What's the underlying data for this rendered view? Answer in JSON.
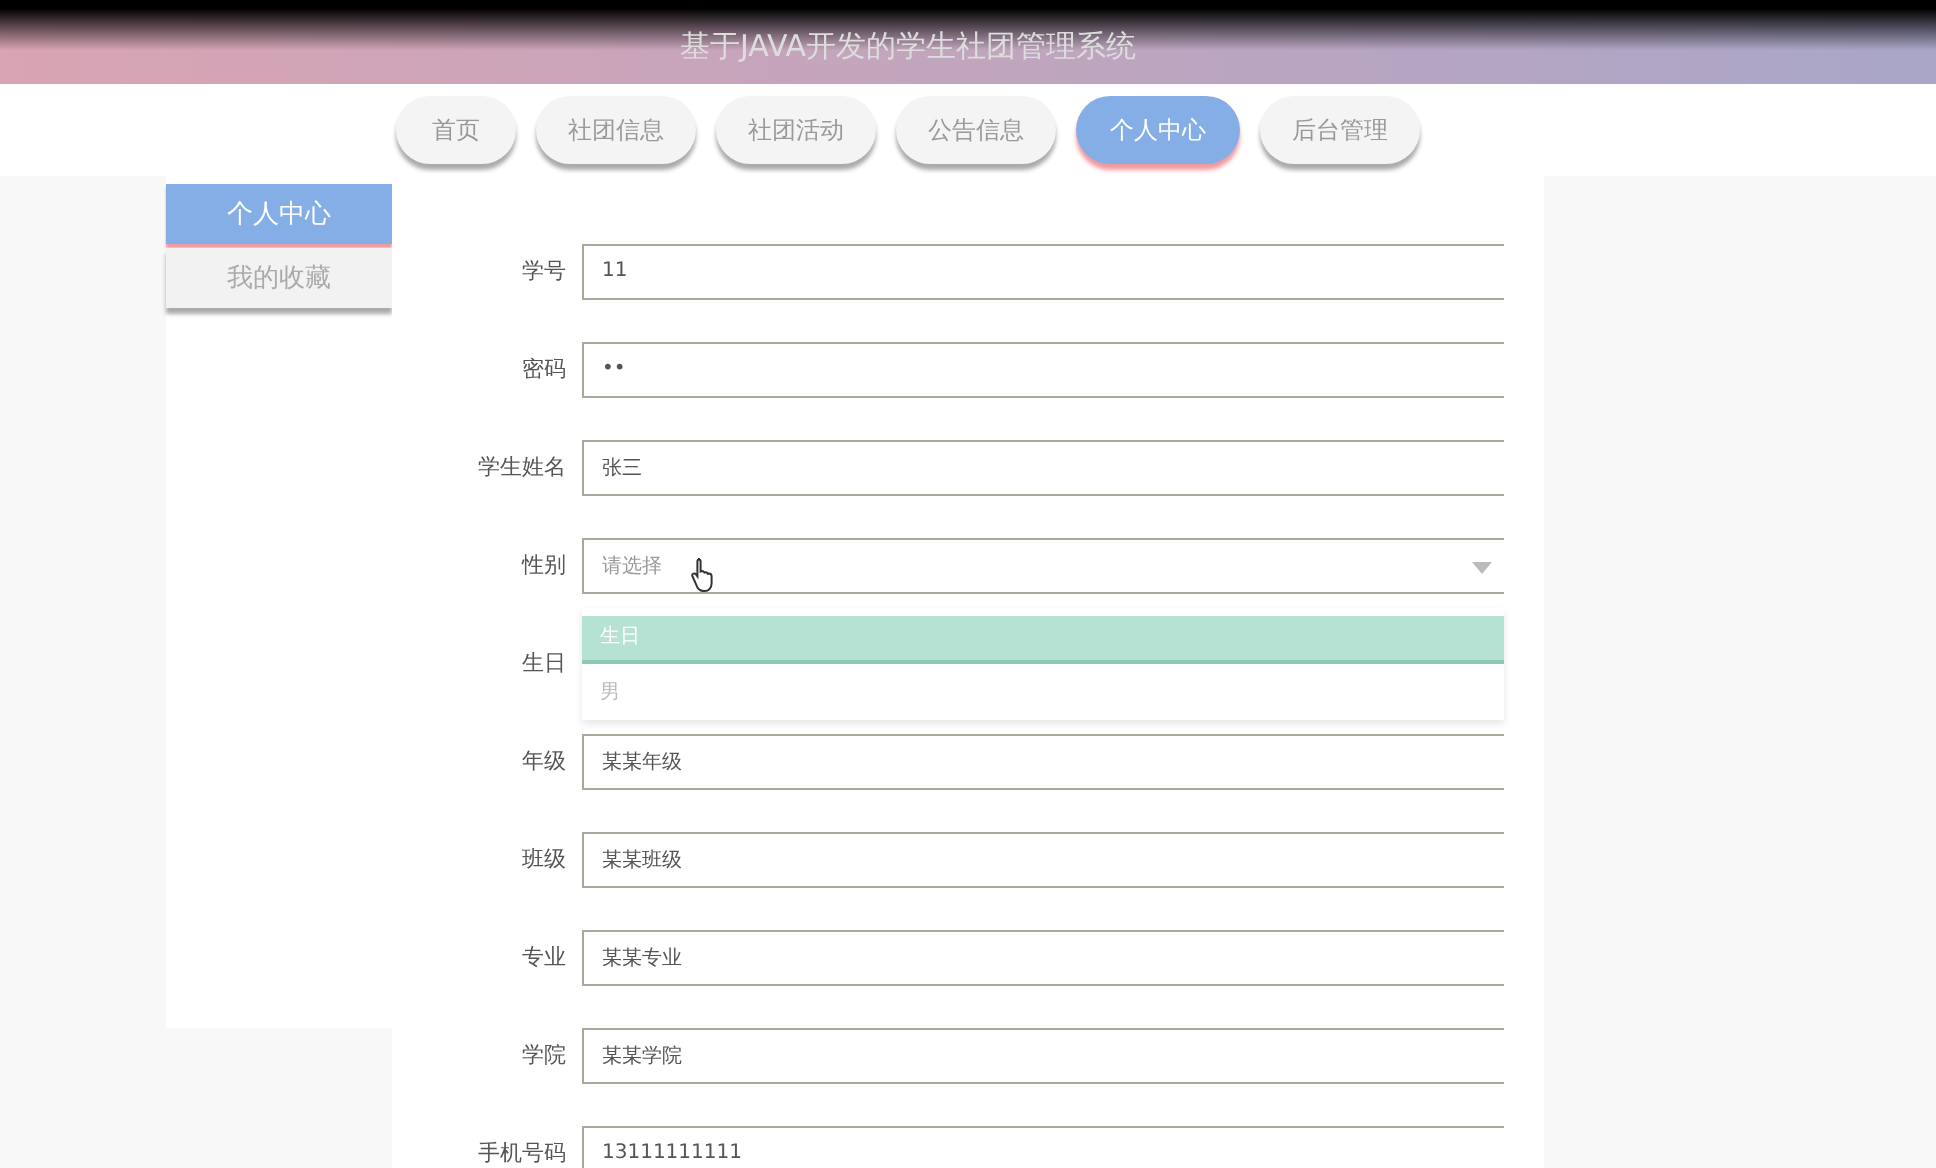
{
  "header": {
    "title": "基于JAVA开发的学生社团管理系统"
  },
  "nav": [
    {
      "label": "首页",
      "selected": false
    },
    {
      "label": "社团信息",
      "selected": false
    },
    {
      "label": "社团活动",
      "selected": false
    },
    {
      "label": "公告信息",
      "selected": false
    },
    {
      "label": "个人中心",
      "selected": true
    },
    {
      "label": "后台管理",
      "selected": false
    }
  ],
  "sidebar": {
    "items": [
      {
        "label": "个人中心",
        "selected": true
      },
      {
        "label": "我的收藏",
        "selected": false
      }
    ]
  },
  "form": {
    "fields": [
      {
        "kind": "text",
        "label": "学号",
        "value": "11"
      },
      {
        "kind": "text",
        "label": "密码",
        "value": "••"
      },
      {
        "kind": "text",
        "label": "学生姓名",
        "value": "张三"
      },
      {
        "kind": "select",
        "label": "性别",
        "placeholder": "请选择",
        "options": [
          {
            "label": "生日",
            "selected": true
          },
          {
            "label": "男",
            "selected": false
          }
        ]
      },
      {
        "kind": "covered",
        "label": "生日"
      },
      {
        "kind": "text",
        "label": "年级",
        "value": "某某年级"
      },
      {
        "kind": "text",
        "label": "班级",
        "value": "某某班级"
      },
      {
        "kind": "text",
        "label": "专业",
        "value": "某某专业"
      },
      {
        "kind": "text",
        "label": "学院",
        "value": "某某学院"
      },
      {
        "kind": "text",
        "label": "手机号码",
        "value": "13111111111"
      }
    ]
  }
}
